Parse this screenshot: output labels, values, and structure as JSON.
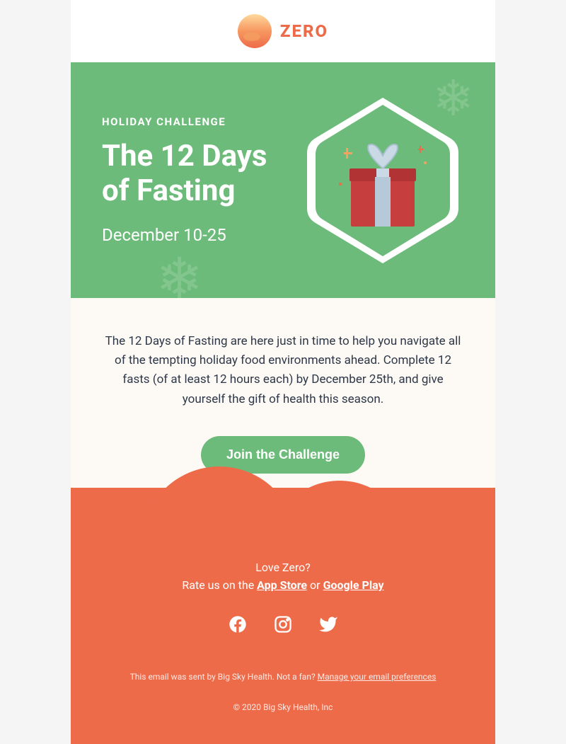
{
  "brand": {
    "name": "ZERO"
  },
  "hero": {
    "eyebrow": "HOLIDAY CHALLENGE",
    "title": "The 12 Days of Fasting",
    "date": "December 10-25"
  },
  "body": {
    "paragraph": "The 12 Days of Fasting are here just in time to help you navigate all of the tempting holiday food environments ahead. Complete 12 fasts (of at least 12 hours each) by December 25th, and give yourself the gift of health this season.",
    "cta": "Join the Challenge"
  },
  "footer": {
    "love": "Love Zero?",
    "rate_prefix": "Rate us on the ",
    "app_store": "App Store",
    "or": " or ",
    "google_play": "Google Play",
    "legal_prefix": "This email was sent by Big Sky Health.  Not a fan? ",
    "manage": "Manage your email preferences",
    "copyright": "© 2020 Big Sky Health, Inc"
  }
}
